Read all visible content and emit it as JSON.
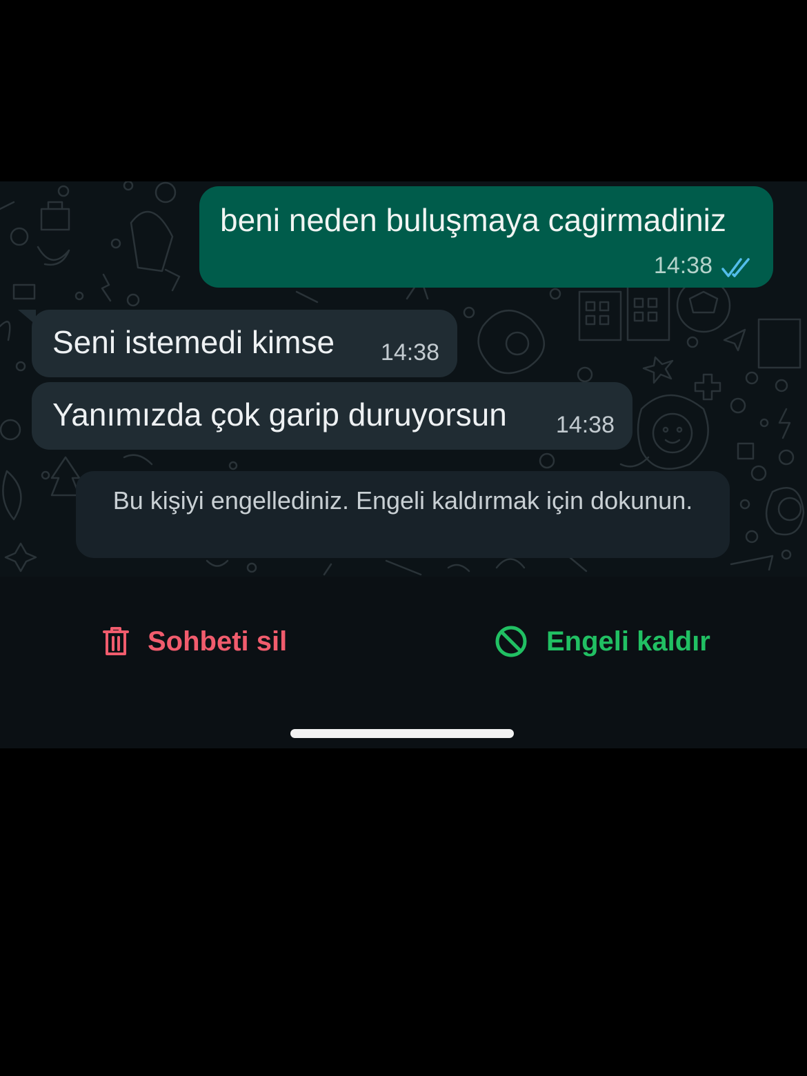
{
  "colors": {
    "outgoing_bubble": "#005c4b",
    "incoming_bubble": "#202c33",
    "notice_bg": "#182229",
    "delete_red": "#f15c6d",
    "unblock_green": "#21c063",
    "read_ticks": "#53bdeb"
  },
  "messages": [
    {
      "direction": "outgoing",
      "text": "beni neden buluşmaya cagirmadiniz",
      "time": "14:38",
      "status_icon": "double-check-read-icon"
    },
    {
      "direction": "incoming",
      "text": "Seni istemedi kimse",
      "time": "14:38"
    },
    {
      "direction": "incoming",
      "text": "Yanımızda çok garip duruyorsun",
      "time": "14:38"
    }
  ],
  "notice": {
    "text": "Bu kişiyi engellediniz. Engeli kaldırmak için dokunun."
  },
  "actions": {
    "delete": {
      "label": "Sohbeti sil",
      "icon": "trash-icon"
    },
    "unblock": {
      "label": "Engeli kaldır",
      "icon": "block-icon"
    }
  }
}
